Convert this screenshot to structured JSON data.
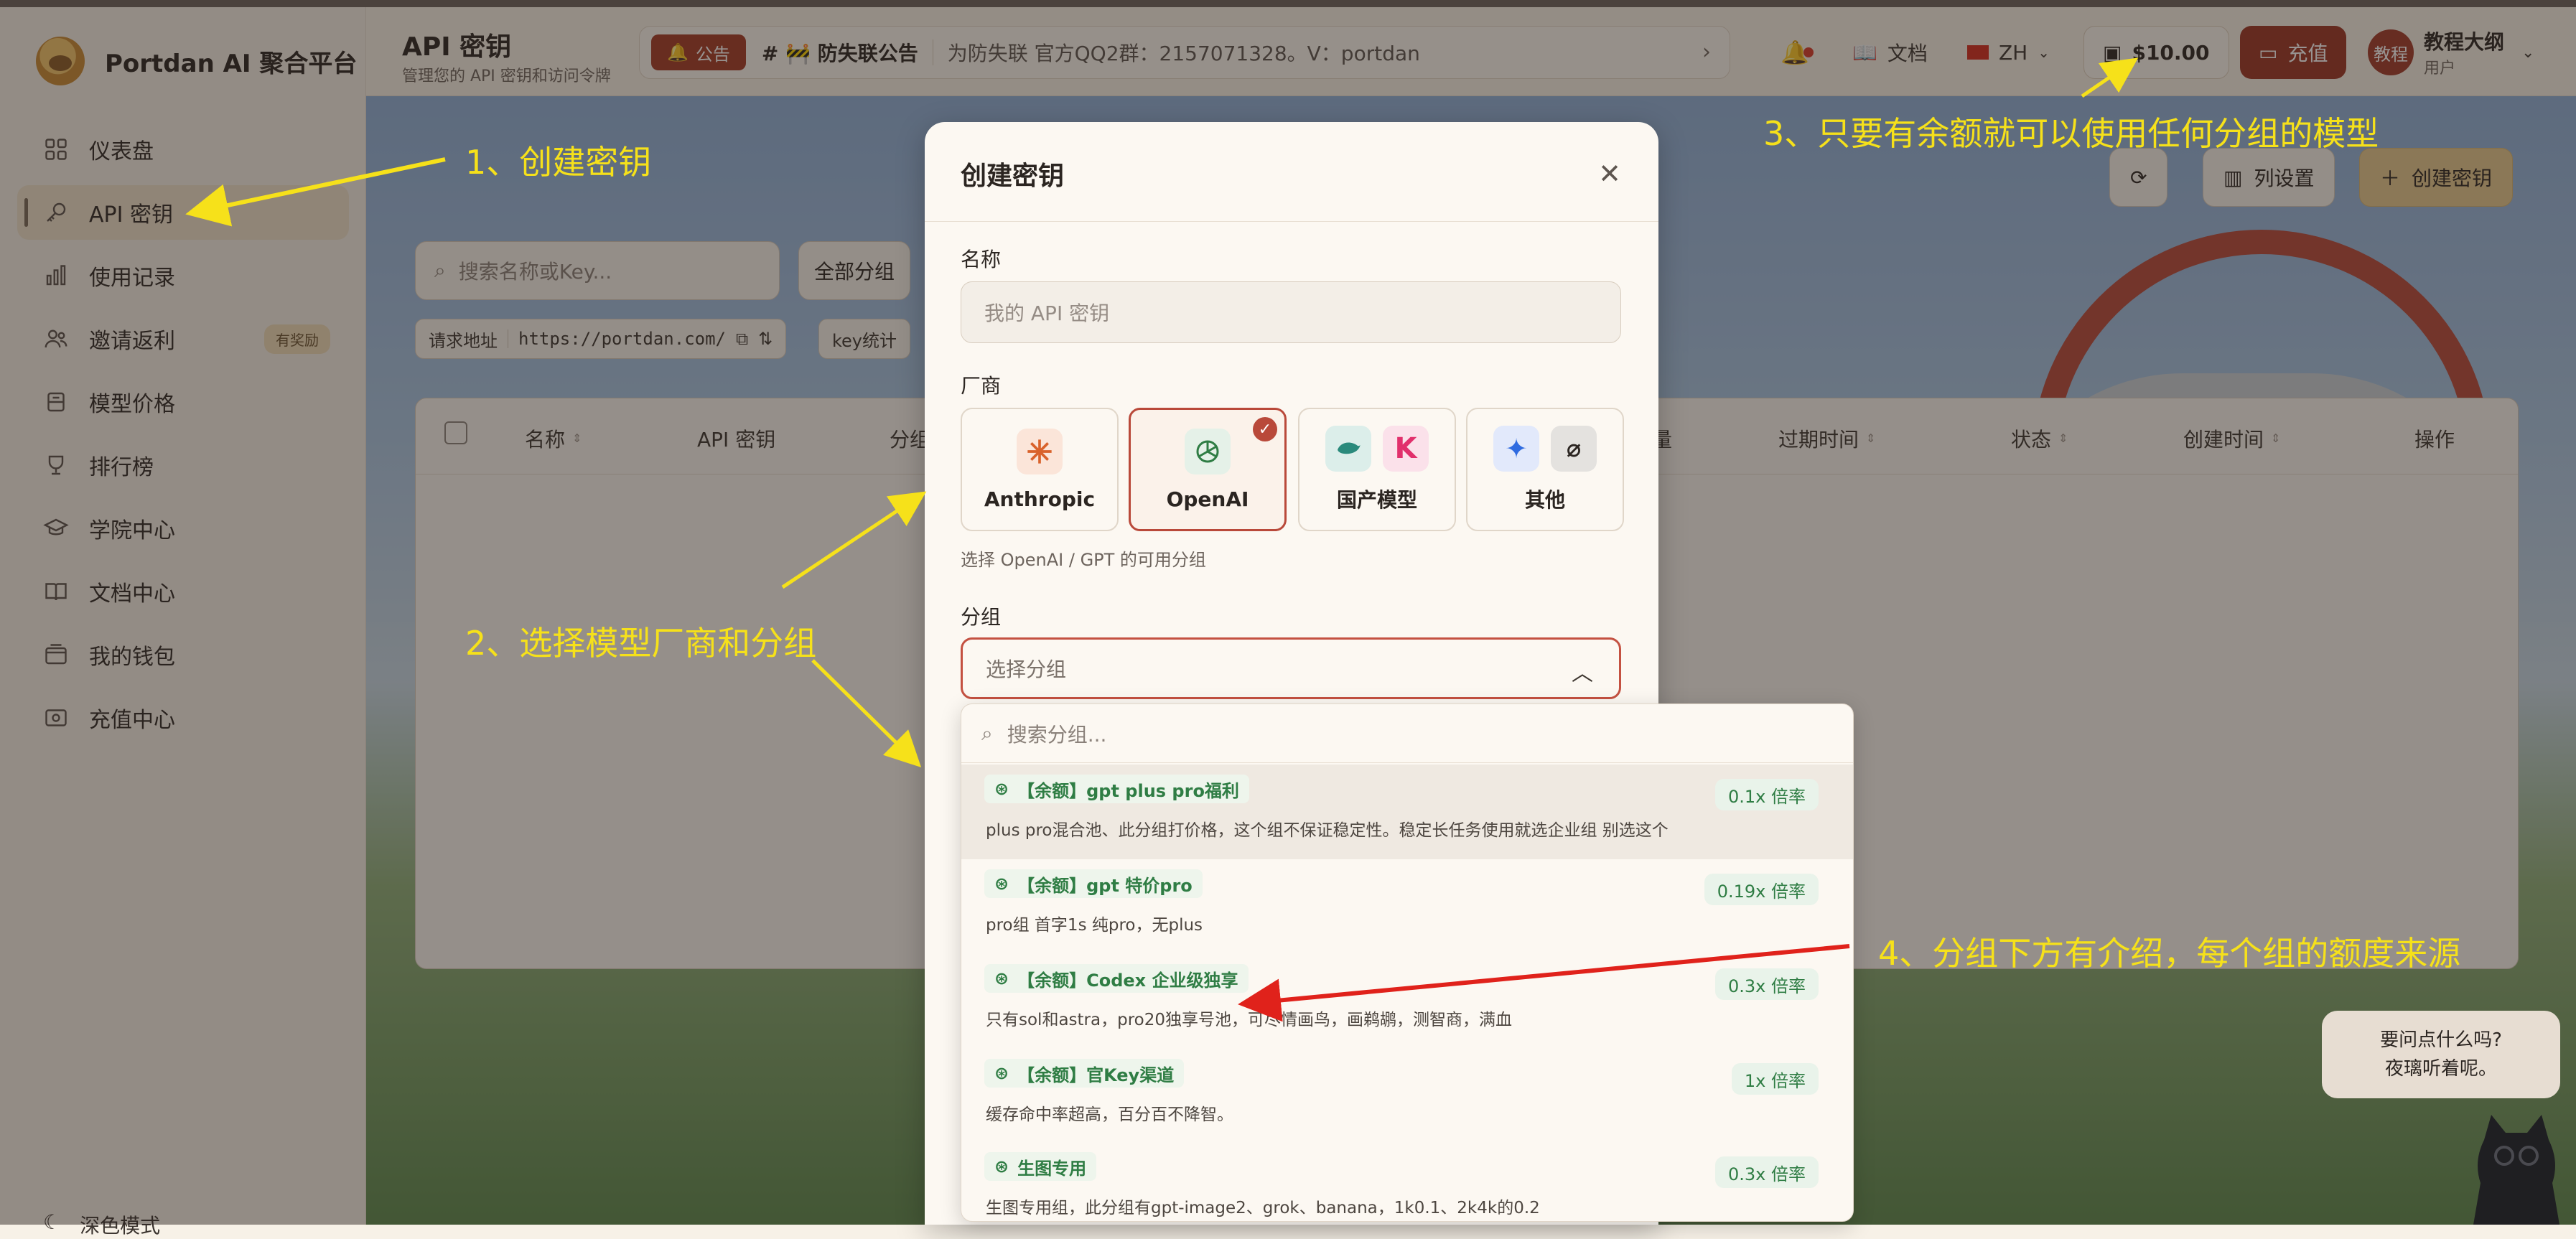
{
  "app": {
    "name": "Portdan AI 聚合平台"
  },
  "sidebar": {
    "items": [
      {
        "label": "仪表盘",
        "icon": "dashboard-icon"
      },
      {
        "label": "API 密钥",
        "icon": "key-icon",
        "active": true
      },
      {
        "label": "使用记录",
        "icon": "chart-icon"
      },
      {
        "label": "邀请返利",
        "icon": "users-icon",
        "badge": "有奖励"
      },
      {
        "label": "模型价格",
        "icon": "tag-icon"
      },
      {
        "label": "排行榜",
        "icon": "trophy-icon"
      },
      {
        "label": "学院中心",
        "icon": "graduation-icon"
      },
      {
        "label": "文档中心",
        "icon": "book-icon"
      },
      {
        "label": "我的钱包",
        "icon": "wallet-icon"
      },
      {
        "label": "充值中心",
        "icon": "recharge-icon"
      }
    ],
    "theme_label": "深色模式"
  },
  "header": {
    "title": "API 密钥",
    "subtitle": "管理您的 API 密钥和访问令牌",
    "notice_tag": "公告",
    "notice_title": "# 🚧 防失联公告",
    "notice_body": "为防失联 官方QQ2群：2157071328。V：portdan",
    "docs": "文档",
    "lang": "ZH",
    "balance": "$10.00",
    "recharge": "充值",
    "avatar": "教程",
    "user_name": "教程大纲",
    "user_role": "用户"
  },
  "main": {
    "search_placeholder": "搜索名称或Key...",
    "filter_all_groups": "全部分组",
    "chip_url_label": "请求地址",
    "chip_url": "https://portdan.com/",
    "chip_stats": "key统计",
    "refresh": "",
    "columns_btn": "列设置",
    "create_btn": "创建密钥",
    "columns": [
      "名称",
      "API 密钥",
      "分组",
      "量",
      "过期时间",
      "状态",
      "创建时间",
      "操作"
    ]
  },
  "modal": {
    "title": "创建密钥",
    "name_label": "名称",
    "name_placeholder": "我的 API 密钥",
    "vendor_label": "厂商",
    "vendors": [
      {
        "name": "Anthropic"
      },
      {
        "name": "OpenAI",
        "selected": true
      },
      {
        "name": "国产模型"
      },
      {
        "name": "其他"
      }
    ],
    "vendor_hint": "选择 OpenAI / GPT 的可用分组",
    "group_label": "分组",
    "group_placeholder": "选择分组"
  },
  "dropdown": {
    "search_placeholder": "搜索分组...",
    "options": [
      {
        "name": "【余额】gpt plus pro福利",
        "desc": "plus pro混合池、此分组打价格，这个组不保证稳定性。稳定长任务使用就选企业组 别选这个",
        "rate": "0.1x 倍率"
      },
      {
        "name": "【余额】gpt 特价pro",
        "desc": "pro组 首字1s 纯pro，无plus",
        "rate": "0.19x 倍率"
      },
      {
        "name": "【余额】Codex 企业级独享",
        "desc": "只有sol和astra，pro20独享号池，可尽情画鸟，画鹈鹕，测智商，满血",
        "rate": "0.3x 倍率"
      },
      {
        "name": "【余额】官Key渠道",
        "desc": "缓存命中率超高，百分百不降智。",
        "rate": "1x 倍率"
      },
      {
        "name": "生图专用",
        "desc": "生图专用组，此分组有gpt-image2、grok、banana，1k0.1、2k4k的0.2",
        "rate": "0.3x 倍率"
      }
    ]
  },
  "annotations": {
    "a1": "1、创建密钥",
    "a2": "2、选择模型厂商和分组",
    "a3": "3、只要有余额就可以使用任何分组的模型",
    "a4": "4、分组下方有介绍，每个组的额度来源"
  },
  "chat": {
    "line1": "要问点什么吗?",
    "line2": "夜璃听着呢。"
  },
  "colors": {
    "accent": "#9c3423",
    "annotation": "#f6e11a",
    "rate_green": "#2f7d44"
  }
}
